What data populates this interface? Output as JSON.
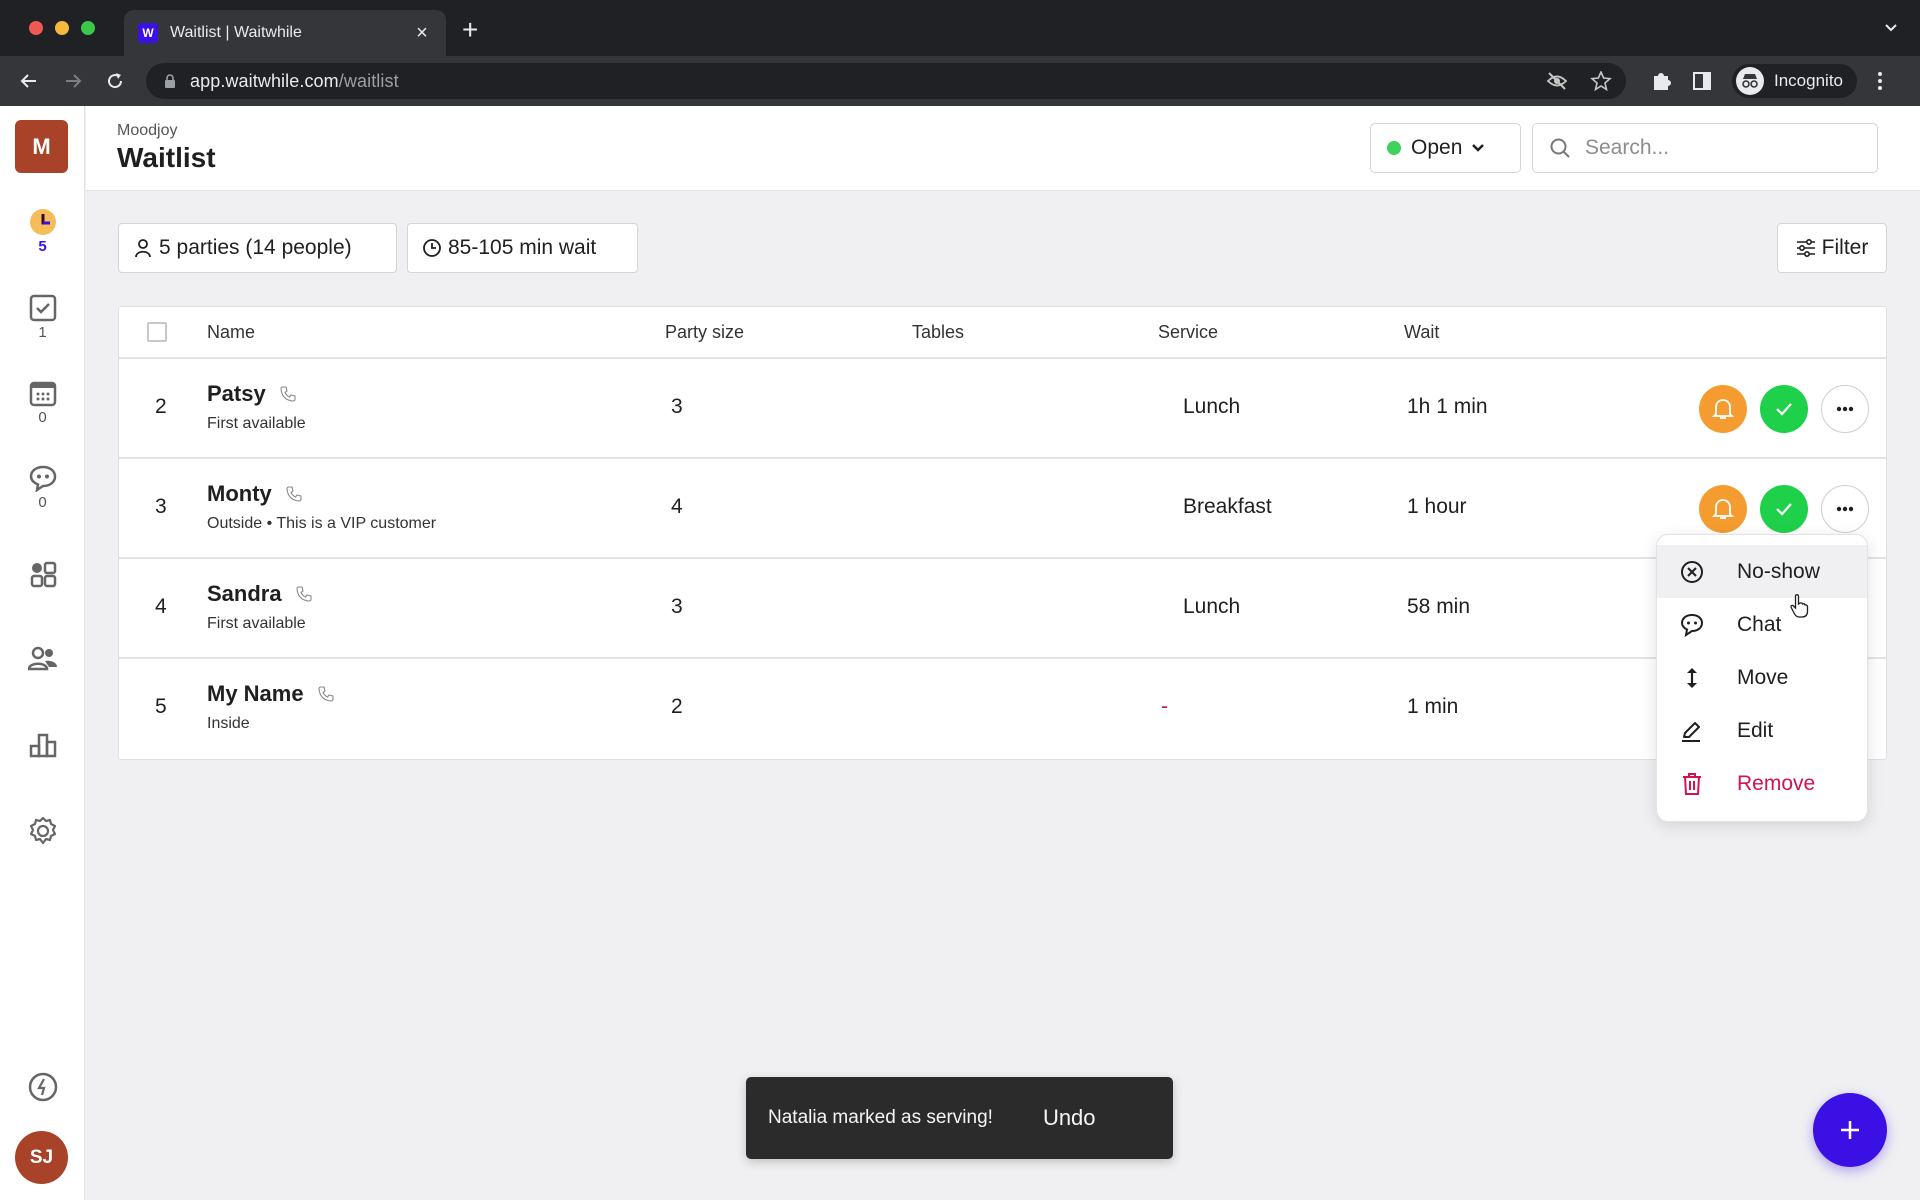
{
  "browser": {
    "tab_title": "Waitlist | Waitwhile",
    "favicon_letter": "W",
    "url_host": "app.waitwhile.com",
    "url_path": "/waitlist",
    "profile_label": "Incognito"
  },
  "sidebar": {
    "org_initial": "M",
    "items": [
      {
        "icon": "clock-icon",
        "count": "5",
        "active": true
      },
      {
        "icon": "checkbox-icon",
        "count": "1"
      },
      {
        "icon": "calendar-icon",
        "count": "0"
      },
      {
        "icon": "chat-icon",
        "count": "0"
      },
      {
        "icon": "apps-icon"
      },
      {
        "icon": "customers-icon"
      },
      {
        "icon": "analytics-icon"
      },
      {
        "icon": "settings-icon"
      }
    ],
    "bolt_icon": "lightning-icon",
    "user_initials": "SJ"
  },
  "header": {
    "org_name": "Moodjoy",
    "title": "Waitlist",
    "status": {
      "label": "Open",
      "color": "#3ed15b"
    },
    "search_placeholder": "Search..."
  },
  "summary": {
    "parties": "5 parties (14 people)",
    "wait": "85-105 min wait",
    "filter_label": "Filter"
  },
  "table": {
    "columns": [
      "Name",
      "Party size",
      "Tables",
      "Service",
      "Wait"
    ],
    "rows": [
      {
        "position": "2",
        "name": "Patsy",
        "note": "First available",
        "party_size": "3",
        "tables": "",
        "service": "Lunch",
        "wait": "1h 1 min"
      },
      {
        "position": "3",
        "name": "Monty",
        "note": "Outside  • This is a VIP customer",
        "party_size": "4",
        "tables": "",
        "service": "Breakfast",
        "wait": "1 hour"
      },
      {
        "position": "4",
        "name": "Sandra",
        "note": "First available",
        "party_size": "3",
        "tables": "",
        "service": "Lunch",
        "wait": "58 min"
      },
      {
        "position": "5",
        "name": "My Name",
        "note": "Inside",
        "party_size": "2",
        "tables": "",
        "service": "-",
        "wait": "1 min"
      }
    ]
  },
  "context_menu": {
    "items": [
      {
        "label": "No-show",
        "icon": "x-circle-icon"
      },
      {
        "label": "Chat",
        "icon": "chat-icon"
      },
      {
        "label": "Move",
        "icon": "move-icon"
      },
      {
        "label": "Edit",
        "icon": "pencil-icon"
      },
      {
        "label": "Remove",
        "icon": "trash-icon",
        "danger": true
      }
    ]
  },
  "toast": {
    "message": "Natalia marked as serving!",
    "action": "Undo"
  },
  "colors": {
    "brand": "#3a10e5",
    "notify": "#f49c30",
    "serve": "#1fd14a",
    "danger": "#d1134f",
    "org_badge": "#a8432a"
  }
}
